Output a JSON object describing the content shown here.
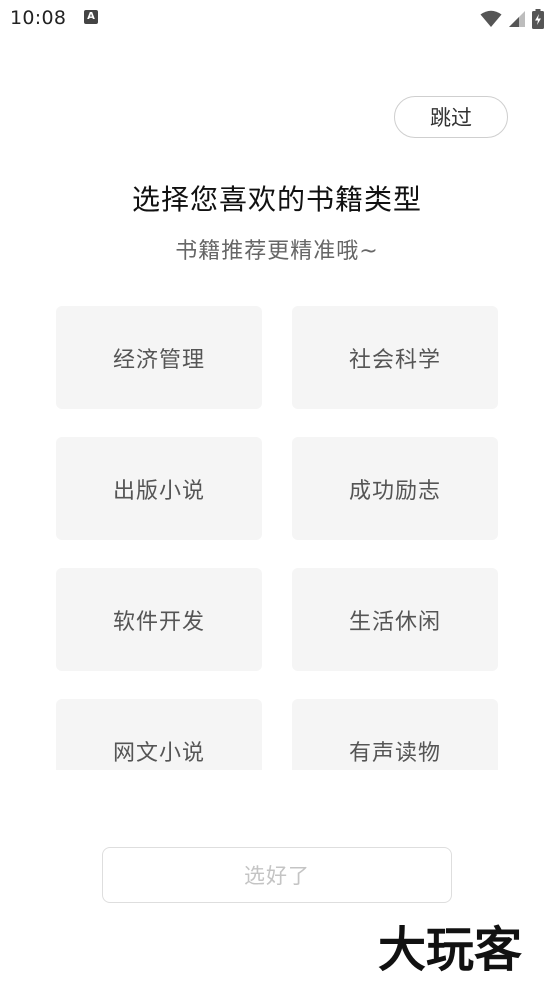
{
  "status_bar": {
    "time": "10:08",
    "notification_icon": "A"
  },
  "header": {
    "skip_label": "跳过"
  },
  "main": {
    "title": "选择您喜欢的书籍类型",
    "subtitle": "书籍推荐更精准哦~",
    "categories": [
      {
        "label": "经济管理"
      },
      {
        "label": "社会科学"
      },
      {
        "label": "出版小说"
      },
      {
        "label": "成功励志"
      },
      {
        "label": "软件开发"
      },
      {
        "label": "生活休闲"
      },
      {
        "label": "网文小说"
      },
      {
        "label": "有声读物"
      }
    ]
  },
  "footer": {
    "confirm_label": "选好了"
  },
  "watermark": {
    "text": "大玩客"
  },
  "colors": {
    "tile_background": "#f5f5f5",
    "tile_text": "#555555",
    "disabled_text": "#c4c4c4",
    "border": "#cfcfcf"
  }
}
